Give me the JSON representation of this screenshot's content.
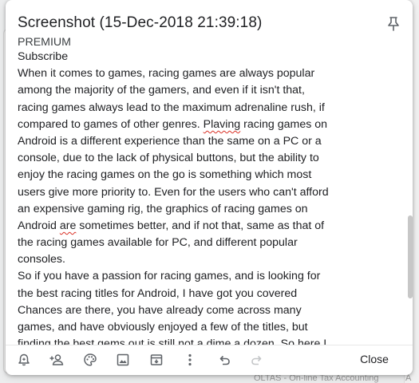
{
  "note": {
    "title": "Screenshot (15-Dec-2018 21:39:18)",
    "lines": {
      "l0": "PREMIUM",
      "l1": "Subscribe",
      "l2": "When it comes to games, racing games are always popular",
      "l3": "among the majority of the gamers, and even if it isn't that,",
      "l4": "racing games always lead to the maximum adrenaline rush, if",
      "l5a": "compared to games of other genres. ",
      "l5b": "Plaving",
      "l5c": " racing games on",
      "l6": "Android is a different experience than the same on a PC or a",
      "l7": "console, due to the lack of physical buttons, but the ability to",
      "l8": "enjoy the racing games on the go is something which most",
      "l9": "users give more priority to. Even for the users who can't afford",
      "l10": "an expensive gaming rig, the graphics of racing games on",
      "l11a": "Android ",
      "l11b": "are",
      "l11c": " sometimes better, and if not that, same as that of",
      "l12": "the racing games available for PC, and different popular",
      "l13": "consoles.",
      "l14": "So if you have a passion for racing games, and is looking for",
      "l15": "the best racing titles for Android, I have got you covered",
      "l16": "Chances are there, you have already come across many",
      "l17": "games, and have obviously enjoyed a few of the titles, but",
      "l18": "finding the best gems out is still not a dime a dozen. So here I"
    }
  },
  "toolbar": {
    "icons": [
      "reminder-icon",
      "collaborator-icon",
      "palette-icon",
      "image-icon",
      "archive-icon",
      "more-icon",
      "undo-icon",
      "redo-icon",
      "pin-icon"
    ],
    "close_label": "Close"
  },
  "background": {
    "footer_text": "OLTAS - On-line Tax Accounting",
    "footer_right": "A"
  }
}
